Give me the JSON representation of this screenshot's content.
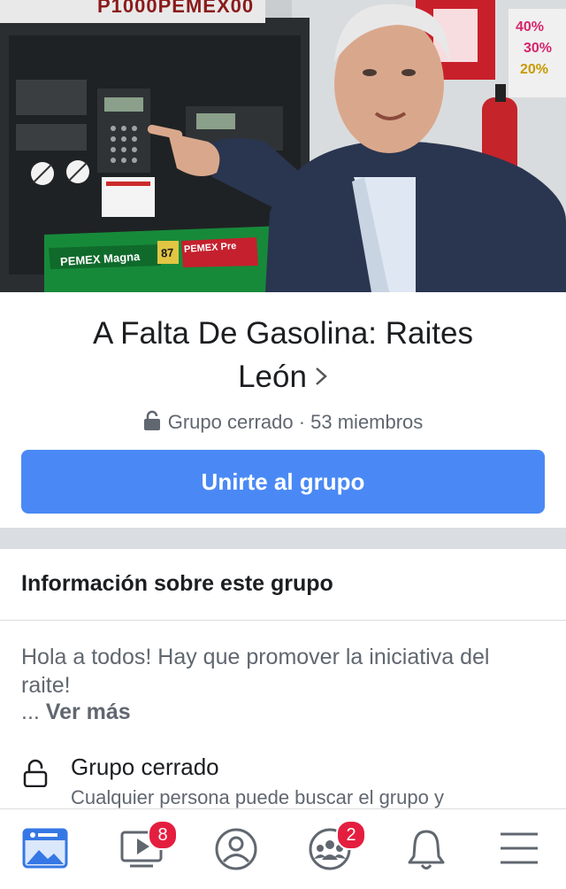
{
  "cover": {
    "brand_text": "P1000PEMEX00",
    "pump_labels": [
      "PEMEX Magna",
      "87",
      "PEMEX Pre"
    ],
    "price_tags": [
      "40%",
      "30%",
      "20%"
    ]
  },
  "group": {
    "title_line1": "A Falta De Gasolina: Raites",
    "title_line2": "León",
    "privacy": "Grupo cerrado",
    "separator": "·",
    "members": "53 miembros",
    "join_label": "Unirte al grupo"
  },
  "about": {
    "heading": "Información sobre este grupo",
    "description": "Hola a todos! Hay que promover la iniciativa del raite!",
    "ellipsis": "...",
    "see_more": "Ver más",
    "privacy_title": "Grupo cerrado",
    "privacy_desc": "Cualquier persona puede buscar el grupo y"
  },
  "nav": {
    "items": [
      {
        "icon": "news-feed-icon",
        "badge": ""
      },
      {
        "icon": "watch-icon",
        "badge": "8"
      },
      {
        "icon": "profile-icon",
        "badge": ""
      },
      {
        "icon": "groups-icon",
        "badge": "2"
      },
      {
        "icon": "notifications-icon",
        "badge": ""
      },
      {
        "icon": "menu-icon",
        "badge": ""
      }
    ]
  },
  "colors": {
    "accent": "#4a89f5",
    "badge": "#e41e3f",
    "divider": "#dadde1"
  }
}
